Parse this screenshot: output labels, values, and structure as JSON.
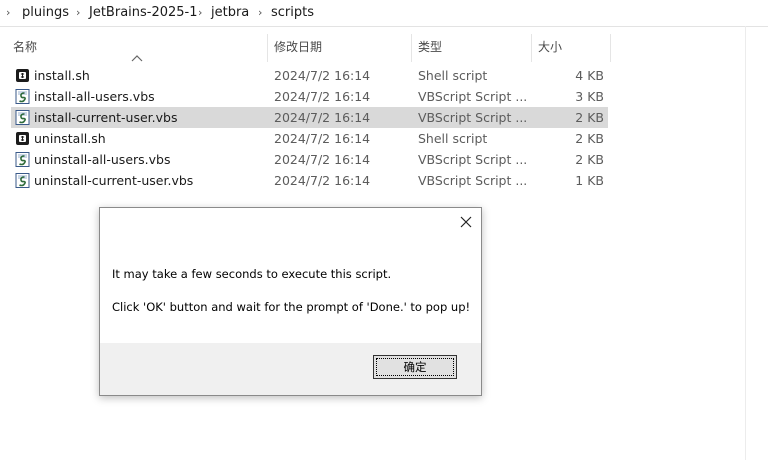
{
  "breadcrumb": [
    "pluings",
    "JetBrains-2025-1",
    "jetbra",
    "scripts"
  ],
  "columns": {
    "name": "名称",
    "date": "修改日期",
    "type": "类型",
    "size": "大小"
  },
  "files": [
    {
      "name": "install.sh",
      "date": "2024/7/2 16:14",
      "type": "Shell script",
      "size": "4 KB",
      "icon": "shell-script-icon",
      "selected": false
    },
    {
      "name": "install-all-users.vbs",
      "date": "2024/7/2 16:14",
      "type": "VBScript Script ...",
      "size": "3 KB",
      "icon": "vbscript-icon",
      "selected": false
    },
    {
      "name": "install-current-user.vbs",
      "date": "2024/7/2 16:14",
      "type": "VBScript Script ...",
      "size": "2 KB",
      "icon": "vbscript-icon",
      "selected": true
    },
    {
      "name": "uninstall.sh",
      "date": "2024/7/2 16:14",
      "type": "Shell script",
      "size": "2 KB",
      "icon": "shell-script-icon",
      "selected": false
    },
    {
      "name": "uninstall-all-users.vbs",
      "date": "2024/7/2 16:14",
      "type": "VBScript Script ...",
      "size": "2 KB",
      "icon": "vbscript-icon",
      "selected": false
    },
    {
      "name": "uninstall-current-user.vbs",
      "date": "2024/7/2 16:14",
      "type": "VBScript Script ...",
      "size": "1 KB",
      "icon": "vbscript-icon",
      "selected": false
    }
  ],
  "dialog": {
    "message_line1": "It may take a few seconds to execute this script.",
    "message_line2": "Click 'OK' button and wait for the prompt of 'Done.' to pop up!",
    "ok_label": "确定"
  },
  "colors": {
    "selected_row": "#d9d9d9",
    "dialog_footer": "#f0f0f0"
  }
}
